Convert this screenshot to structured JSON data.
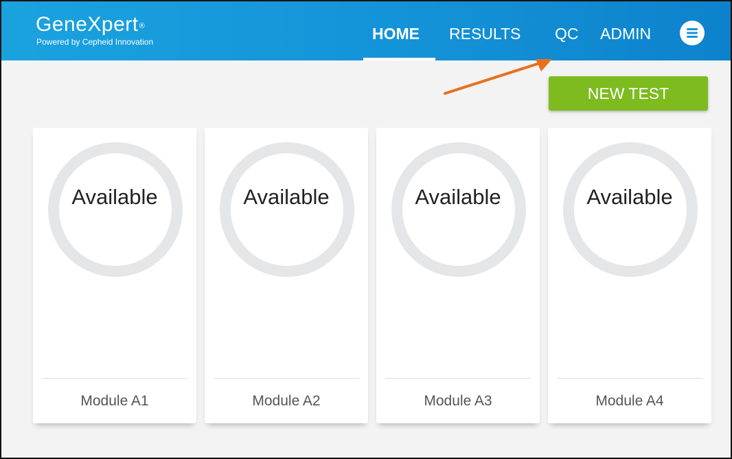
{
  "header": {
    "brand": "GeneXpert",
    "brand_mark": "®",
    "tagline": "Powered by Cepheid Innovation",
    "colors": {
      "bar": "#1493d8",
      "text": "#ffffff"
    }
  },
  "nav": {
    "items": [
      {
        "label": "HOME",
        "active": true
      },
      {
        "label": "RESULTS",
        "active": false
      },
      {
        "label": "QC",
        "active": false
      },
      {
        "label": "ADMIN",
        "active": false
      }
    ],
    "menu_icon": "menu-icon"
  },
  "actions": {
    "new_test_label": "NEW TEST",
    "new_test_color": "#7dbb1f"
  },
  "annotation": {
    "arrow_icon": "arrow-icon",
    "arrow_color": "#e8701c"
  },
  "modules": [
    {
      "status": "Available",
      "label": "Module A1"
    },
    {
      "status": "Available",
      "label": "Module A2"
    },
    {
      "status": "Available",
      "label": "Module A3"
    },
    {
      "status": "Available",
      "label": "Module A4"
    }
  ]
}
